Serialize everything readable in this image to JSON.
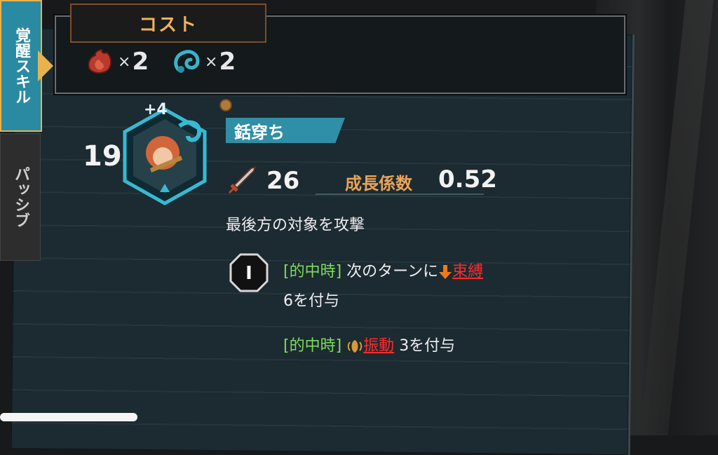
{
  "tabs": {
    "awaken_label": "覚醒スキル",
    "passive_label": "パッシブ"
  },
  "cost": {
    "title": "コスト",
    "items": [
      {
        "icon": "red-flame-icon",
        "count": "2",
        "color": "#c0392b"
      },
      {
        "icon": "blue-spiral-icon",
        "count": "2",
        "color": "#3ab3c7"
      }
    ],
    "times_symbol": "×"
  },
  "skill": {
    "level": "19",
    "plus": "+4",
    "name": "銛穿ち",
    "power_icon": "dagger-icon",
    "power": "26",
    "growth_label": "成長係数",
    "growth_value": "0.52",
    "description": "最後方の対象を攻撃",
    "stage_badge": "I",
    "effects": [
      {
        "trigger": "[的中時]",
        "text_a": "次のターンに",
        "debuff_icon": "down-arrow-icon",
        "debuff_name": "束縛",
        "text_b": "6を付与"
      },
      {
        "trigger": "[的中時]",
        "debuff_icon": "vibration-icon",
        "debuff_name": "振動",
        "text_b": "3を付与"
      }
    ]
  },
  "colors": {
    "accent_teal": "#2f8fa7",
    "accent_orange": "#e9a45a",
    "trigger_green": "#7ddc5b",
    "debuff_red": "#ff2b2b"
  }
}
